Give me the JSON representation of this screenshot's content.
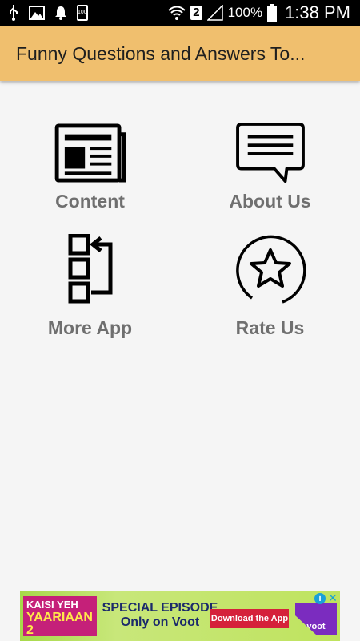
{
  "status_bar": {
    "icons_left": [
      "usb-icon",
      "image-icon",
      "notification-bell-icon",
      "battery-saver-icon"
    ],
    "battery_small_text": "100",
    "sim_number": "2",
    "battery_percent": "100%",
    "time": "1:38 PM",
    "icons_right": [
      "wifi-icon",
      "signal-icon",
      "battery-icon"
    ]
  },
  "app_bar": {
    "title": "Funny Questions and Answers To..."
  },
  "menu": {
    "items": [
      {
        "label": "Content",
        "icon": "newspaper-icon"
      },
      {
        "label": "About Us",
        "icon": "chat-bubble-icon"
      },
      {
        "label": "More App",
        "icon": "more-apps-icon"
      },
      {
        "label": "Rate Us",
        "icon": "star-circle-icon"
      }
    ]
  },
  "ad": {
    "brand_line1": "KAISI YEH",
    "brand_line2": "YAARIAAN 2",
    "headline_line1": "SPECIAL EPISODE",
    "headline_line2": "Only on Voot",
    "cta": "Download the App",
    "logo": "voot",
    "info_glyph": "i",
    "close_glyph": "✕"
  },
  "colors": {
    "app_bar": "#f0bf6e",
    "label_gray": "#6f6f6f",
    "background": "#f5f5f5"
  }
}
